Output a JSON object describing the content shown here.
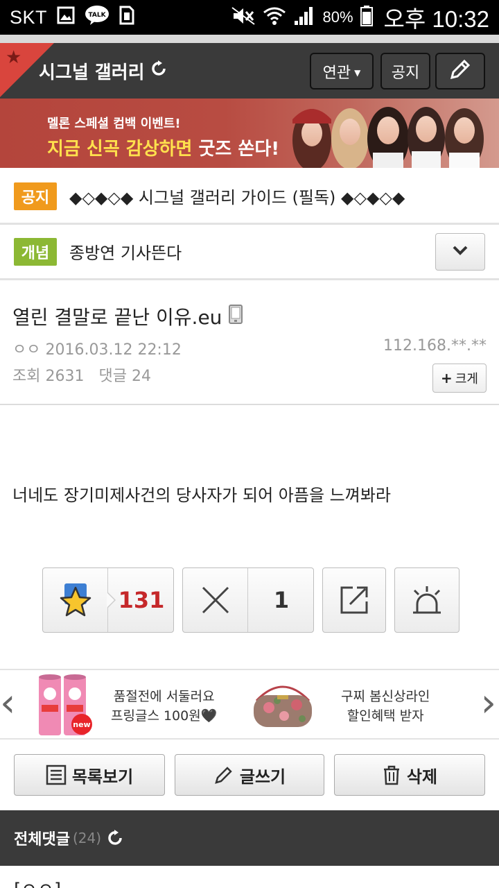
{
  "status_bar": {
    "carrier": "SKT",
    "talk_label": "TALK",
    "battery": "80%",
    "time": "오후 10:32"
  },
  "gallery_header": {
    "title": "시그널 갤러리",
    "related_button": "연관",
    "notice_button": "공지"
  },
  "banner": {
    "line1": "멜론 스페셜 컴백 이벤트!",
    "line2_prefix": "지금 신곡 감상하면 ",
    "line2_emph": "굿즈 쏜다!"
  },
  "notices": [
    {
      "tag": "공지",
      "text": "◆◇◆◇◆ 시그널 갤러리 가이드 (필독) ◆◇◆◇◆"
    },
    {
      "tag": "개념",
      "text": "종방연 기사뜬다"
    }
  ],
  "post": {
    "title": "열린 결말로 끝난 이유.eu",
    "author": "ㅇㅇ",
    "datetime": "2016.03.12 22:12",
    "ip": "112.168.**.**",
    "views_label": "조회",
    "views": "2631",
    "comments_label": "댓글",
    "comments": "24",
    "size_button": "크게",
    "body": "너네도 장기미제사건의 당사자가 되어 아픔을 느껴봐라"
  },
  "actions": {
    "recommend_count": "131",
    "dislike_count": "1"
  },
  "ads": [
    {
      "line1": "품절전에 서둘러요",
      "line2": "프링글스 100원🖤",
      "badge": "new"
    },
    {
      "line1": "구찌 봄신상라인",
      "line2": "할인혜택 받자"
    }
  ],
  "bottom_buttons": {
    "list": "목록보기",
    "write": "글쓰기",
    "delete": "삭제"
  },
  "comments_section": {
    "title": "전체댓글",
    "count": "(24)",
    "first_comment_peek": "[ㅇㅇ]"
  },
  "colors": {
    "header_bg": "#3a3a3a",
    "notice_tag": "#f09a1d",
    "concept_tag": "#8cb834",
    "recommend_number": "#c5282a"
  }
}
